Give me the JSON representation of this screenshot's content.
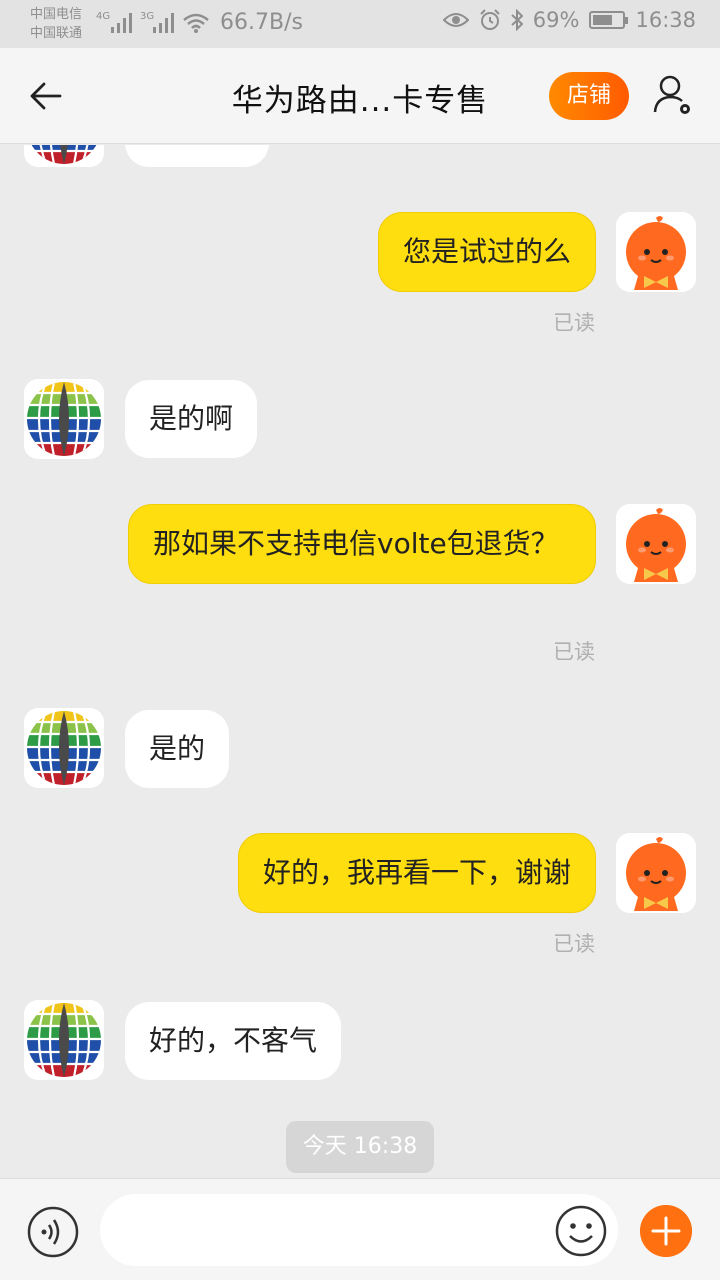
{
  "status_bar": {
    "carrier1": "中国电信",
    "carrier2": "中国联通",
    "net1": "4G",
    "net2": "3G",
    "speed": "66.7B/s",
    "battery_percent": "69%",
    "battery_level": 0.69,
    "time": "16:38"
  },
  "header": {
    "title": "华为路由...卡专售",
    "shop_label": "店铺"
  },
  "messages": [
    {
      "side": "out",
      "text": "您是试过的么",
      "status": "已读"
    },
    {
      "side": "in",
      "text": "是的啊"
    },
    {
      "side": "out",
      "text": "那如果不支持电信volte包退货？",
      "status": "已读"
    },
    {
      "side": "in",
      "text": "是的"
    },
    {
      "side": "out",
      "text": "好的，我再看一下，谢谢",
      "status": "已读"
    },
    {
      "side": "in",
      "text": "好的，不客气"
    }
  ],
  "timestamp": "今天  16:38",
  "input": {
    "value": "",
    "placeholder": ""
  },
  "colors": {
    "accent": "#ff6a00",
    "outgoing_bubble": "#ffde10",
    "incoming_bubble": "#ffffff",
    "background": "#ebebeb"
  },
  "icons": {
    "back": "arrow-left-icon",
    "user_settings": "user-gear-icon",
    "voice": "voice-icon",
    "emoji": "smiley-icon",
    "plus": "plus-icon",
    "seller_avatar": "globe-logo-icon",
    "user_avatar": "orange-mascot-icon"
  }
}
